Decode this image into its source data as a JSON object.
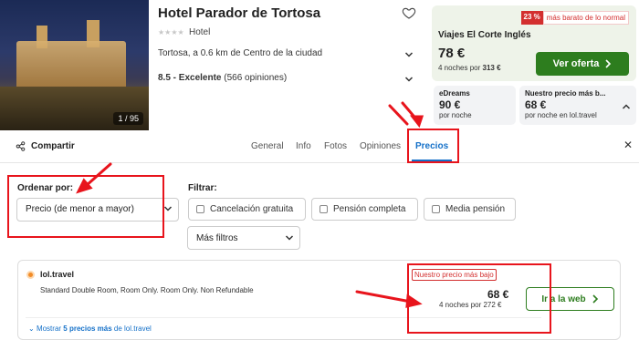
{
  "hotel": {
    "name": "Hotel Parador de Tortosa",
    "stars_glyph": "★★★★",
    "type": "Hotel",
    "location": "Tortosa, a 0.6 km de Centro de la ciudad",
    "rating_score": "8.5 - Excelente",
    "rating_count": "(566 opiniones)",
    "photo_counter": "1 / 95"
  },
  "best_offer": {
    "discount_pct": "23 %",
    "discount_text": "más barato de lo normal",
    "provider": "Viajes El Corte Inglés",
    "price": "78 €",
    "total_prefix": "4 noches por",
    "total_value": "313 €",
    "button_label": "Ver oferta",
    "bg_color": "#eef3e9",
    "button_color": "#2d7d1e"
  },
  "mini_offers": [
    {
      "name": "eDreams",
      "price": "90 €",
      "sub": "por noche"
    },
    {
      "name": "Nuestro precio más b...",
      "price": "68 €",
      "sub": "por noche en lol.travel"
    }
  ],
  "tabs": {
    "share": "Compartir",
    "items": [
      "General",
      "Info",
      "Fotos",
      "Opiniones",
      "Precios"
    ],
    "active": "Precios",
    "active_color": "#1470c8"
  },
  "sort": {
    "label": "Ordenar por:",
    "value": "Precio (de menor a mayor)"
  },
  "filter": {
    "label": "Filtrar:",
    "options": [
      "Cancelación gratuita",
      "Pensión completa",
      "Media pensión"
    ],
    "more": "Más filtros"
  },
  "result": {
    "provider": "lol.travel",
    "description": "Standard Double Room, Room Only. Room Only. Non Refundable",
    "badge": "Nuestro precio más bajo",
    "price": "68 €",
    "total": "4 noches por 272 €",
    "button_label": "Ir a la web",
    "more_prefix": "Mostrar",
    "more_count": "5 precios más",
    "more_suffix": "de lol.travel"
  },
  "annotation_color": "#e8141c"
}
